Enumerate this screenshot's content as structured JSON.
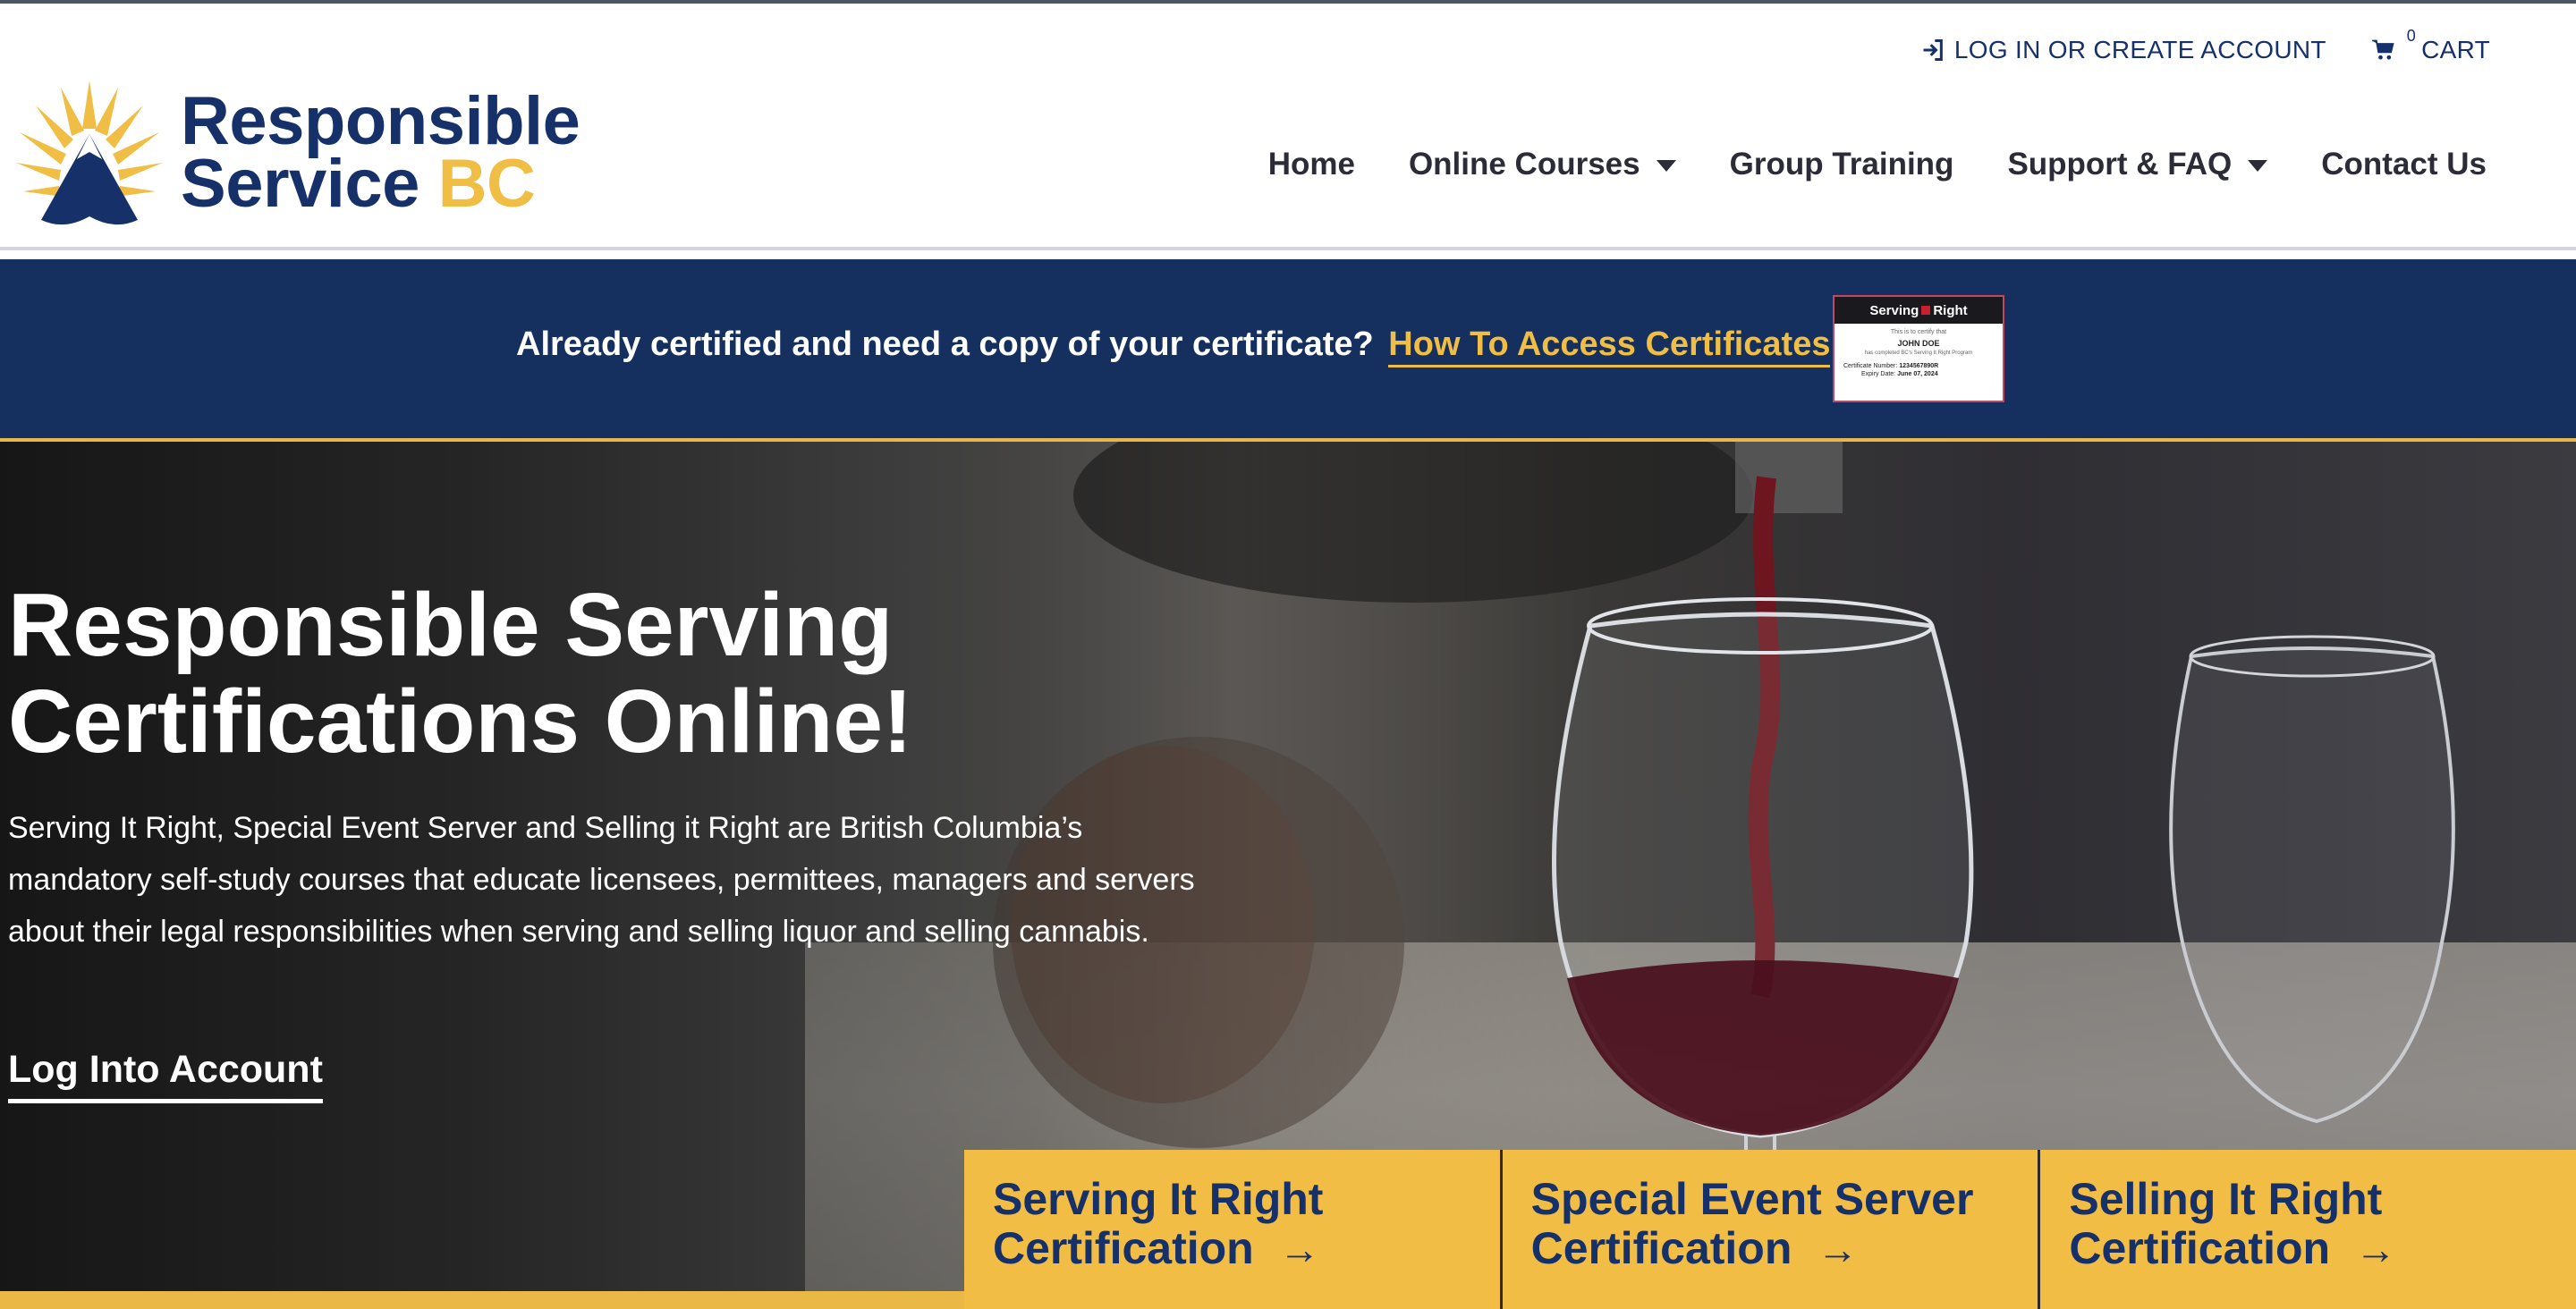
{
  "header": {
    "brand_line1": "Responsible",
    "brand_line2": "Service",
    "brand_accent": "BC",
    "login_label": "LOG IN OR CREATE ACCOUNT",
    "cart_count": "0",
    "cart_label": "CART",
    "nav": [
      {
        "label": "Home"
      },
      {
        "label": "Online Courses"
      },
      {
        "label": "Group Training"
      },
      {
        "label": "Support & FAQ"
      },
      {
        "label": "Contact Us"
      }
    ]
  },
  "banner": {
    "text": "Already certified and need a copy of your certificate?",
    "link": "How To Access Certificates",
    "certificate": {
      "title": "Serving",
      "title_b": "Right",
      "line1": "This is to certify that",
      "name": "JOHN DOE",
      "line3": "has completed BC's Serving It Right Program",
      "number_label": "Certificate Number:",
      "number": "1234567890R",
      "expiry_label": "Expiry Date:",
      "expiry": "June 07, 2024"
    }
  },
  "hero": {
    "title": "Responsible Serving Certifications Online!",
    "description": "Serving It Right, Special Event Server and Selling it Right are British Columbia’s mandatory self-study courses that educate licensees, permittees, managers and servers about their legal responsibilities when serving and selling liquor and selling cannabis.",
    "cta": "Log Into Account",
    "cards": [
      {
        "line1": "Serving It Right",
        "line2": "Certification"
      },
      {
        "line1": "Special Event Server",
        "line2": "Certification"
      },
      {
        "line1": "Selling It Right",
        "line2": "Certification"
      }
    ]
  },
  "colors": {
    "navy": "#15305f",
    "gold": "#f0bd45",
    "text_dark": "#2c2c38"
  }
}
